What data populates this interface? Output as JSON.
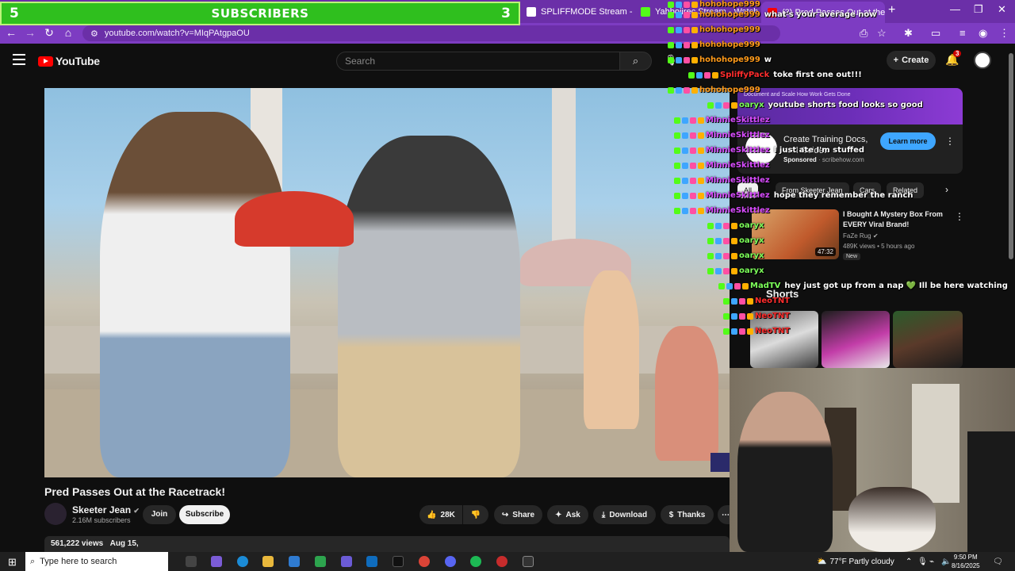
{
  "browser": {
    "tabs": [
      {
        "label": "SPLIFFMODE Stream - Watch Li",
        "active": false
      },
      {
        "label": "Yahboiirec Stream - Watch Live",
        "active": false
      },
      {
        "label": "(3) Pred Passes Out at the R",
        "active": true
      }
    ],
    "url": "youtube.com/watch?v=MIqPAtgpaOU"
  },
  "overlay": {
    "left_num": "5",
    "label": "SUBSCRIBERS",
    "right_num": "3"
  },
  "youtube": {
    "logo": "YouTube",
    "search_placeholder": "Search",
    "create_label": "Create",
    "notif_count": "3"
  },
  "video": {
    "title": "Pred Passes Out at the Racetrack!",
    "channel": "Skeeter Jean",
    "subscribers": "2.16M subscribers",
    "join_label": "Join",
    "subscribe_label": "Subscribe",
    "likes": "28K",
    "share_label": "Share",
    "ask_label": "Ask",
    "download_label": "Download",
    "thanks_label": "Thanks",
    "views": "561,222 views",
    "date": "Aug 15,"
  },
  "sidebar": {
    "ad": {
      "banner": "Document and Scale How Work Gets Done",
      "title": "Create Training Docs, and Guides",
      "sponsored": "Sponsored",
      "domain": "scribehow.com",
      "cta": "Learn more"
    },
    "chips": [
      "All",
      "From Skeeter Jean",
      "Cars",
      "Related"
    ],
    "related": {
      "title": "I Bought A Mystery Box From EVERY Viral Brand!",
      "channel": "FaZe Rug",
      "meta": "489K views • 5 hours ago",
      "badge": "New",
      "duration": "47:32"
    },
    "shorts_heading": "Shorts"
  },
  "chat": [
    {
      "user": "hohohope999",
      "color": "#ff9b1a",
      "text": ""
    },
    {
      "user": "hohohope999",
      "color": "#ff9b1a",
      "text": "what's your average now"
    },
    {
      "user": "hohohope999",
      "color": "#ff9b1a",
      "text": ""
    },
    {
      "user": "hohohope999",
      "color": "#ff9b1a",
      "text": ""
    },
    {
      "user": "hohohope999",
      "color": "#ff9b1a",
      "text": "w"
    },
    {
      "user": "SpliffyPack",
      "color": "#ff2d2d",
      "text": "toke first one out!!!"
    },
    {
      "user": "hohohope999",
      "color": "#ff9b1a",
      "text": ""
    },
    {
      "user": "oaryx",
      "color": "#7cff5a",
      "text": "youtube shorts food looks so good"
    },
    {
      "user": "MinnieSkittlez",
      "color": "#d94cff",
      "text": ""
    },
    {
      "user": "MinnieSkittlez",
      "color": "#d94cff",
      "text": ""
    },
    {
      "user": "MinnieSkittlez",
      "color": "#d94cff",
      "text": "I just ate I'm stuffed"
    },
    {
      "user": "MinnieSkittlez",
      "color": "#d94cff",
      "text": ""
    },
    {
      "user": "MinnieSkittlez",
      "color": "#d94cff",
      "text": ""
    },
    {
      "user": "MinnieSkittlez",
      "color": "#d94cff",
      "text": "hope they remember the ranch"
    },
    {
      "user": "MinnieSkittlez",
      "color": "#d94cff",
      "text": ""
    },
    {
      "user": "oaryx",
      "color": "#7cff5a",
      "text": ""
    },
    {
      "user": "oaryx",
      "color": "#7cff5a",
      "text": ""
    },
    {
      "user": "oaryx",
      "color": "#7cff5a",
      "text": ""
    },
    {
      "user": "oaryx",
      "color": "#7cff5a",
      "text": ""
    },
    {
      "user": "MadTV",
      "color": "#7cff5a",
      "text": "hey just got up from a nap 💚 Ill be here watching"
    },
    {
      "user": "NeoTNT",
      "color": "#ff2d2d",
      "text": ""
    },
    {
      "user": "NeoTNT",
      "color": "#ff2d2d",
      "text": ""
    },
    {
      "user": "NeoTNT",
      "color": "#ff2d2d",
      "text": ""
    }
  ],
  "taskbar": {
    "search_placeholder": "Type here to search",
    "weather": "77°F  Partly cloudy",
    "time": "9:50 PM",
    "date": "8/16/2025"
  }
}
